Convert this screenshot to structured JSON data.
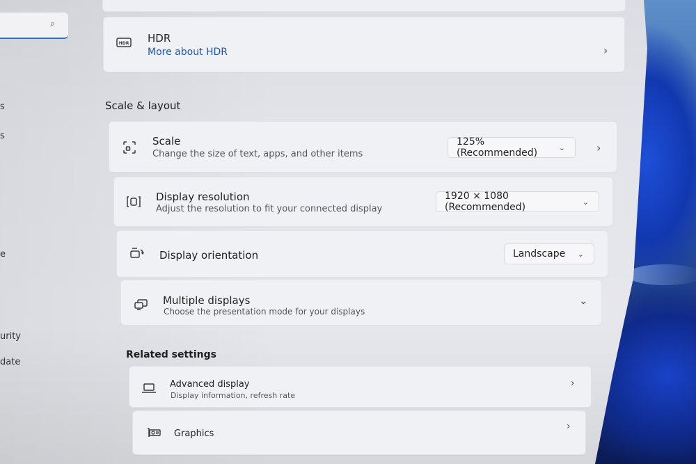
{
  "nav": {
    "fragments": [
      "s",
      "s",
      "e",
      "urity",
      "date"
    ]
  },
  "hdr": {
    "title": "HDR",
    "link": "More about HDR",
    "icon": "hdr-icon"
  },
  "scale_layout": {
    "heading": "Scale & layout",
    "scale": {
      "title": "Scale",
      "subtitle": "Change the size of text, apps, and other items",
      "value": "125% (Recommended)"
    },
    "resolution": {
      "title": "Display resolution",
      "subtitle": "Adjust the resolution to fit your connected display",
      "value": "1920 × 1080 (Recommended)"
    },
    "orientation": {
      "title": "Display orientation",
      "value": "Landscape"
    },
    "multiple": {
      "title": "Multiple displays",
      "subtitle": "Choose the presentation mode for your displays"
    }
  },
  "related": {
    "heading": "Related settings",
    "advanced": {
      "title": "Advanced display",
      "subtitle": "Display information, refresh rate"
    },
    "graphics": {
      "title": "Graphics"
    }
  },
  "colors": {
    "link": "#1f56b3",
    "accent": "#2f6bd4"
  }
}
